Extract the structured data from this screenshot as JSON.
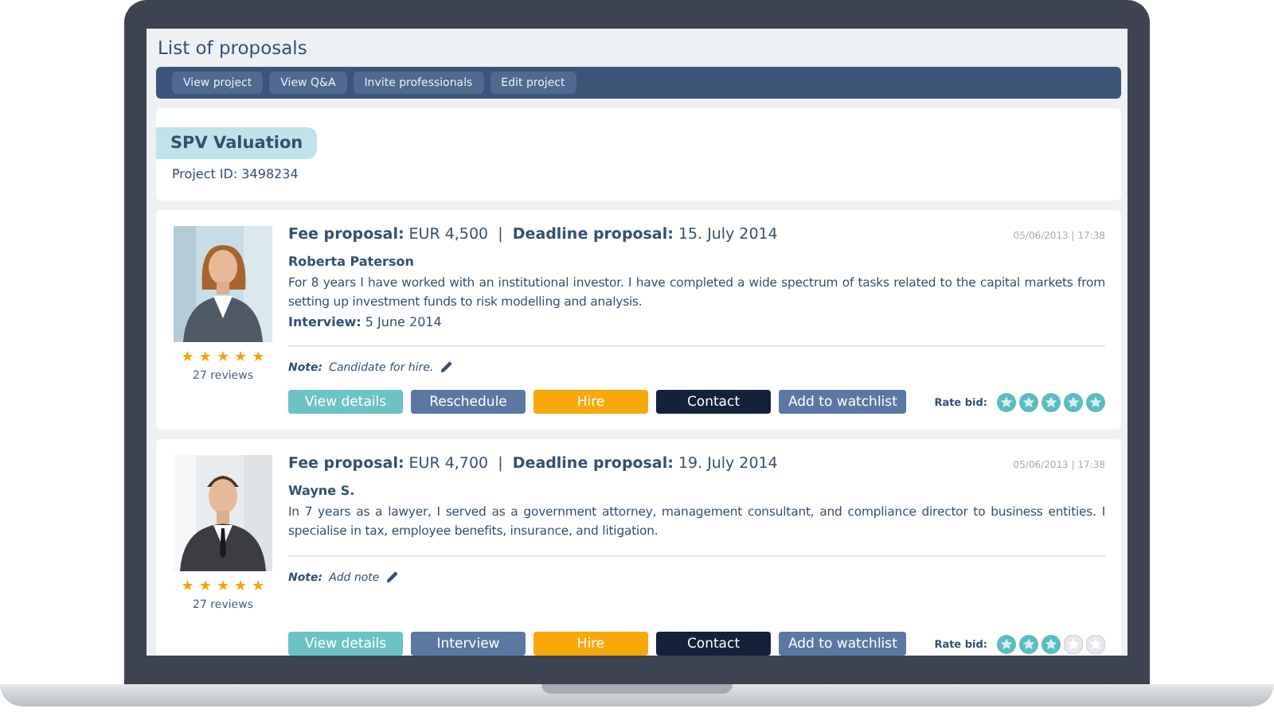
{
  "page_title": "List of proposals",
  "toolbar": [
    "View project",
    "View Q&A",
    "Invite professionals",
    "Edit project"
  ],
  "project": {
    "name": "SPV Valuation",
    "id_label": "Project ID: 3498234"
  },
  "proposals": [
    {
      "fee_label": "Fee proposal:",
      "fee": "EUR 4,500",
      "separator": "|",
      "deadline_label": "Deadline proposal:",
      "deadline": "15. July 2014",
      "timestamp": "05/06/2013 | 17:38",
      "name": "Roberta Paterson",
      "bio": "For 8 years I have worked with an institutional investor. I have completed a wide spectrum of tasks related to the capital markets from setting up investment funds to risk modelling and analysis.",
      "interview_label": "Interview:",
      "interview": "5 June 2014",
      "stars": 5,
      "reviews": "27 reviews",
      "note_label": "Note:",
      "note": "Candidate for hire.",
      "buttons": [
        {
          "label": "View details",
          "kind": "details"
        },
        {
          "label": "Reschedule",
          "kind": "secondary"
        },
        {
          "label": "Hire",
          "kind": "hire"
        },
        {
          "label": "Contact",
          "kind": "contact"
        },
        {
          "label": "Add to watchlist",
          "kind": "secondary"
        }
      ],
      "rate_label": "Rate bid:",
      "rating": {
        "stars": 5
      }
    },
    {
      "fee_label": "Fee proposal:",
      "fee": "EUR 4,700",
      "separator": "|",
      "deadline_label": "Deadline proposal:",
      "deadline": "19. July 2014",
      "timestamp": "05/06/2013 | 17:38",
      "name": "Wayne S.",
      "bio": "In 7 years as a lawyer, I served as a government attorney, management consultant, and compliance director to business entities. I specialise in tax, employee benefits, insurance, and litigation.",
      "stars": 5,
      "reviews": "27 reviews",
      "note_label": "Note:",
      "note": "Add note",
      "buttons": [
        {
          "label": "View details",
          "kind": "details"
        },
        {
          "label": "Interview",
          "kind": "secondary"
        },
        {
          "label": "Hire",
          "kind": "hire"
        },
        {
          "label": "Contact",
          "kind": "contact"
        },
        {
          "label": "Add to watchlist",
          "kind": "secondary"
        }
      ],
      "rate_label": "Rate bid:",
      "rating": {
        "stars": 3
      }
    }
  ]
}
